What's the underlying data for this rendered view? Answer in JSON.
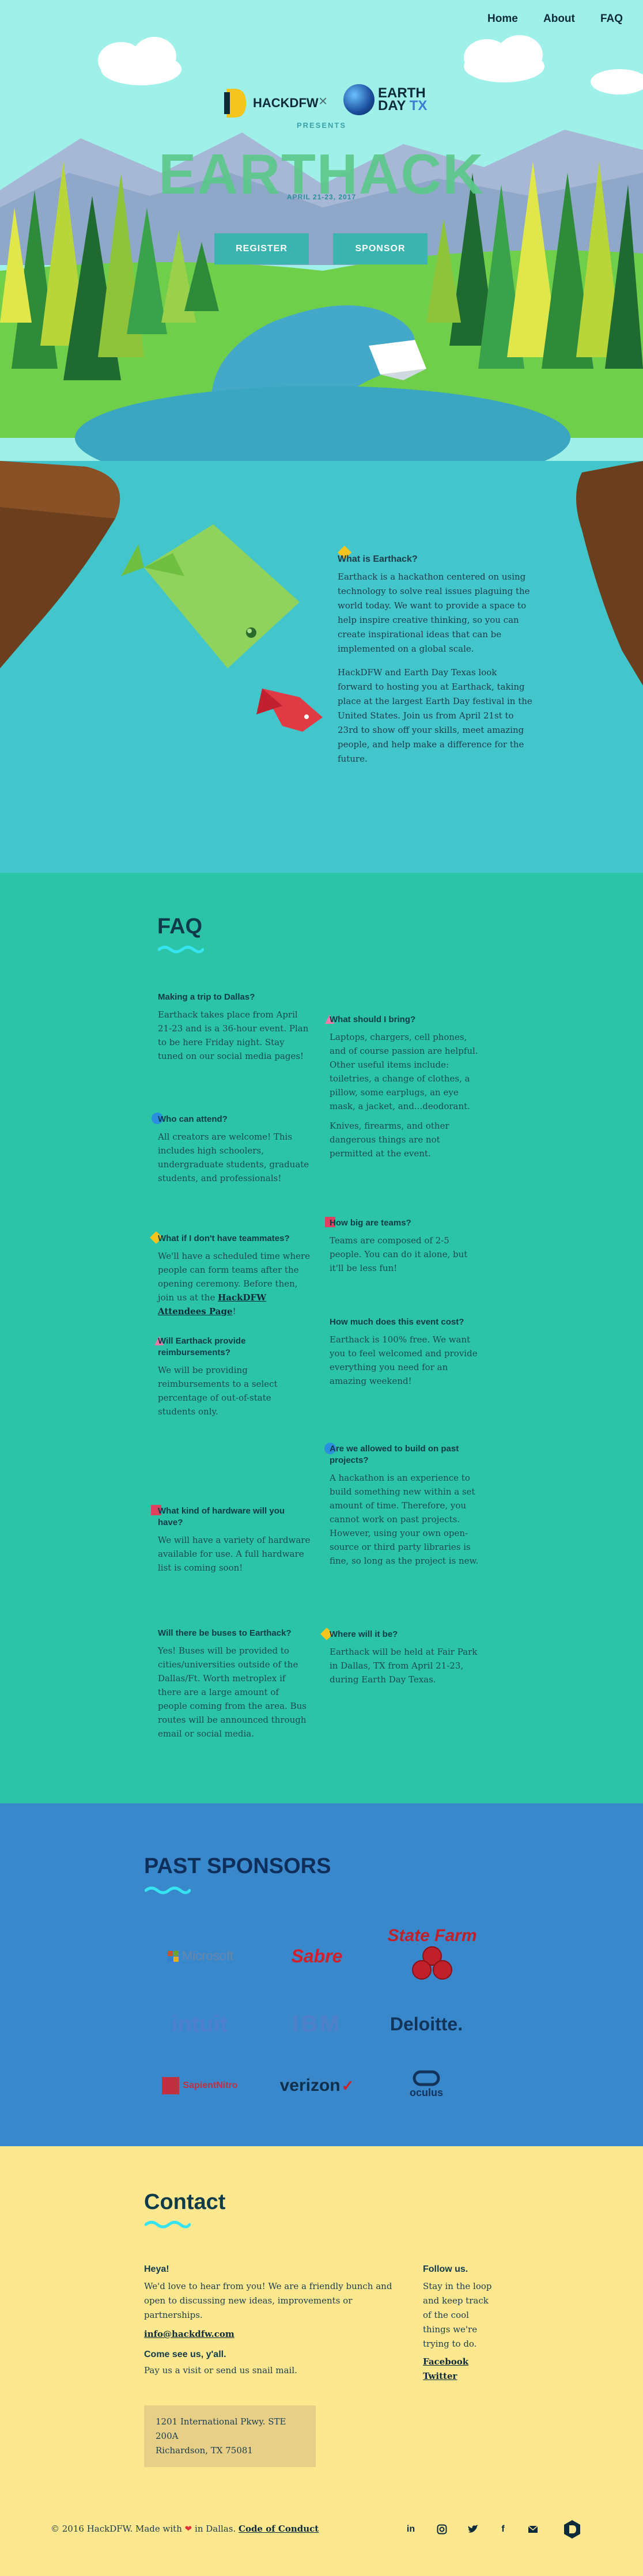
{
  "nav": {
    "home": "Home",
    "about": "About",
    "faq": "FAQ"
  },
  "hero": {
    "hackdfw_logo": "HACKDFW",
    "times": "×",
    "earthday_logo_line1": "EARTH",
    "earthday_logo_line2": "DAY",
    "earthday_logo_tx": "TX",
    "presents": "PRESENTS",
    "title": "EARTHACK",
    "date": "APRIL 21-23, 2017",
    "register_label": "REGISTER",
    "sponsor_label": "SPONSOR"
  },
  "about": {
    "heading": "What is Earthack?",
    "p1": "Earthack is a hackathon centered on using technology to solve real issues plaguing the world today. We want to provide a space to help inspire creative thinking, so you can create inspirational ideas that can be implemented on a global scale.",
    "p2": "HackDFW and Earth Day Texas look forward to hosting you at Earthack, taking place at the largest Earth Day festival in the United States. Join us from April 21st to 23rd to show off your skills, meet amazing people, and help make a difference for the future."
  },
  "faq": {
    "title": "FAQ",
    "left": [
      {
        "q": "Making a trip to Dallas?",
        "a": [
          "Earthack takes place from April 21-23 and is a 36-hour event. Plan to be here Friday night. Stay tuned on our social media pages!"
        ]
      },
      {
        "q": "Who can attend?",
        "a": [
          "All creators are welcome! This includes high schoolers, undergraduate students, graduate students, and professionals!"
        ]
      },
      {
        "q": "What if I don't have teammates?",
        "a": [
          "We'll have a scheduled time where people can form teams after the opening ceremony. Before then, join us at the"
        ],
        "link": "HackDFW Attendees Page",
        "after": "!"
      },
      {
        "q": "Will Earthack provide reimbursements?",
        "a": [
          "We will be providing reimbursements to a select percentage of out-of-state students only."
        ]
      },
      {
        "q": "What kind of hardware will you have?",
        "a": [
          "We will have a variety of hardware available for use. A full hardware list is coming soon!"
        ]
      },
      {
        "q": "Will there be buses to Earthack?",
        "a": [
          "Yes! Buses will be provided to cities/universities outside of the Dallas/Ft. Worth metroplex if there are a large amount of people coming from the area. Bus routes will be announced through email or social media."
        ]
      }
    ],
    "right": [
      {
        "q": "What should I bring?",
        "a": [
          "Laptops, chargers, cell phones, and of course passion are helpful. Other useful items include: toiletries, a change of clothes, a pillow, some earplugs, an eye mask, a jacket, and...deodorant.",
          "Knives, firearms, and other dangerous things are not permitted at the event."
        ]
      },
      {
        "q": "How big are teams?",
        "a": [
          "Teams are composed of 2-5 people. You can do it alone, but it'll be less fun!"
        ]
      },
      {
        "q": "How much does this event cost?",
        "a": [
          "Earthack is 100% free. We want you to feel welcomed and provide everything you need for an amazing weekend!"
        ]
      },
      {
        "q": "Are we allowed to build on past projects?",
        "a": [
          "A hackathon is an experience to build something new within a set amount of time. Therefore, you cannot work on past projects. However, using your own open-source or third party libraries is fine, so long as the project is new."
        ]
      },
      {
        "q": "Where will it be?",
        "a": [
          "Earthack will be held at Fair Park in Dallas, TX from April 21-23, during Earth Day Texas."
        ]
      }
    ]
  },
  "sponsors": {
    "title": "PAST SPONSORS",
    "logos": [
      "Microsoft",
      "Sabre",
      "State Farm",
      "intuit",
      "IBM",
      "Deloitte.",
      "SapientNitro",
      "verizon",
      "oculus"
    ]
  },
  "contact": {
    "title": "Contact",
    "heya": "Heya!",
    "intro": "We'd love to hear from you! We are a friendly bunch and open to discussing new ideas, improvements or partnerships.",
    "email": "info@hackdfw.com",
    "come_see": "Come see us, y'all.",
    "visit": "Pay us a visit or send us snail mail.",
    "address_line1": "1201 International Pkwy. STE 200A",
    "address_line2": "Richardson, TX 75081",
    "follow": "Follow us.",
    "follow_text": "Stay in the loop and keep track of the cool things we're trying to do.",
    "facebook": "Facebook",
    "twitter": "Twitter"
  },
  "footer": {
    "copyright": "© 2016 HackDFW. Made with",
    "in_dallas": "in Dallas.",
    "conduct": "Code of Conduct",
    "social_icons": [
      "linkedin-icon",
      "instagram-icon",
      "twitter-icon",
      "facebook-icon",
      "email-icon",
      "hackdfw-icon"
    ]
  },
  "colors": {
    "faq_bg": "#2bc4a6",
    "sponsors_bg": "#3a88cc",
    "contact_bg": "#fde78f",
    "accent_wave": "#35e4f0"
  }
}
